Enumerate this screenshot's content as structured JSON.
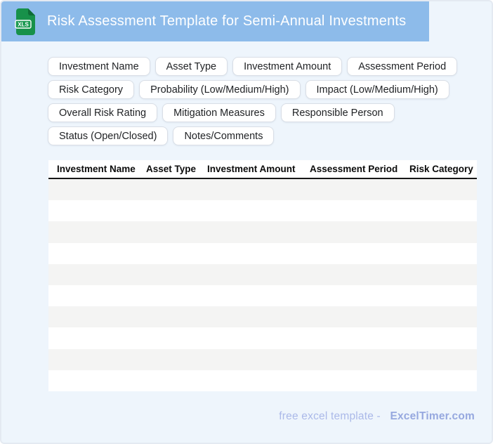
{
  "page": {
    "title": "Risk Assessment Template for Semi-Annual Investments"
  },
  "header": {
    "file_icon_label": "XLS"
  },
  "chips": {
    "rows": [
      [
        "Investment Name",
        "Asset Type",
        "Investment Amount",
        "Assessment Period"
      ],
      [
        "Risk Category",
        "Probability (Low/Medium/High)",
        "Impact (Low/Medium/High)"
      ],
      [
        "Overall Risk Rating",
        "Mitigation Measures",
        "Responsible Person"
      ],
      [
        "Status (Open/Closed)",
        "Notes/Comments"
      ]
    ]
  },
  "table": {
    "columns": [
      "Investment Name",
      "Asset Type",
      "Investment Amount",
      "Assessment Period",
      "Risk Category"
    ],
    "empty_row_count": 10
  },
  "footer": {
    "text": "free excel template -",
    "brand": "ExcelTimer.com"
  },
  "colors": {
    "header_bar": "#8dbbea",
    "page_background": "#eef5fc",
    "icon_green": "#17914a",
    "icon_fold_green": "#0e6d36",
    "row_stripe": "#f4f4f3",
    "head_underline": "#161616",
    "footer_text": "#abb9e9",
    "footer_brand": "#96a8df"
  }
}
